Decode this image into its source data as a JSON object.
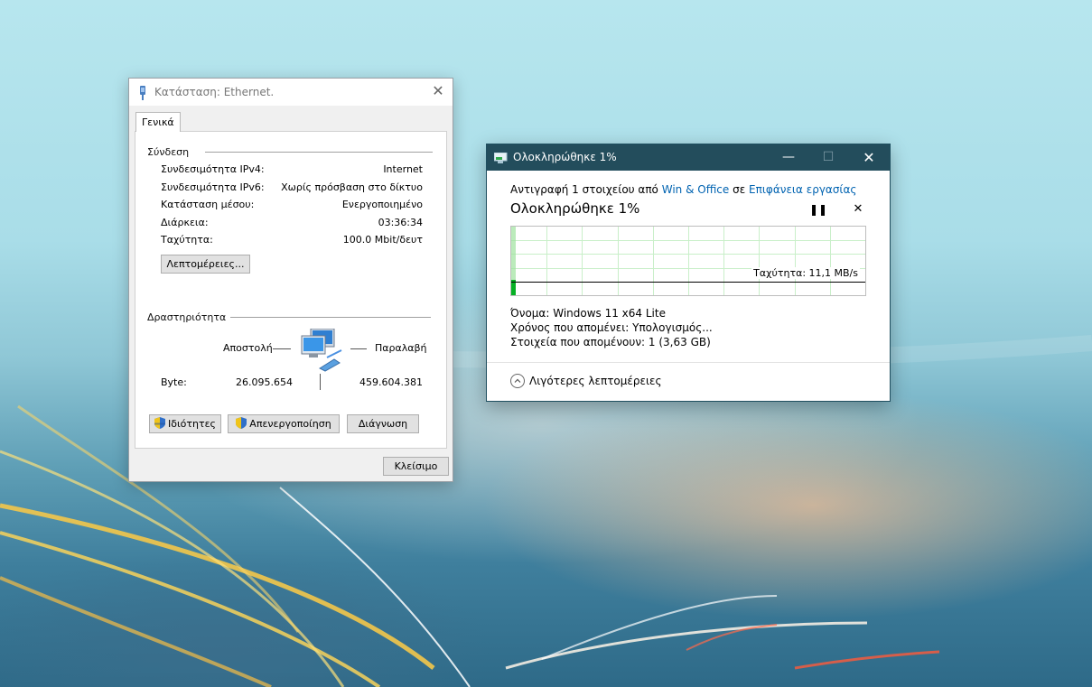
{
  "ethernet_dialog": {
    "title": "Κατάσταση: Ethernet.",
    "tab": "Γενικά",
    "connection": {
      "header": "Σύνδεση",
      "rows": [
        {
          "label": "Συνδεσιμότητα IPv4:",
          "value": "Internet"
        },
        {
          "label": "Συνδεσιμότητα IPv6:",
          "value": "Χωρίς πρόσβαση στο δίκτυο"
        },
        {
          "label": "Κατάσταση μέσου:",
          "value": "Ενεργοποιημένο"
        },
        {
          "label": "Διάρκεια:",
          "value": "03:36:34"
        },
        {
          "label": "Ταχύτητα:",
          "value": "100.0 Mbit/δευτ"
        }
      ],
      "details_button": "Λεπτομέρειες..."
    },
    "activity": {
      "header": "Δραστηριότητα",
      "sent_label": "Αποστολή",
      "received_label": "Παραλαβή",
      "bytes_label": "Byte:",
      "bytes_sent": "26.095.654",
      "bytes_received": "459.604.381"
    },
    "buttons": {
      "properties": "Ιδιότητες",
      "disable": "Απενεργοποίηση",
      "diagnose": "Διάγνωση",
      "close": "Κλείσιμο"
    }
  },
  "copy_dialog": {
    "title": "Ολοκληρώθηκε 1%",
    "copy_prefix": "Αντιγραφή 1 στοιχείου από",
    "source": "Win & Office",
    "to_word": "σε",
    "destination": "Επιφάνεια εργασίας",
    "heading": "Ολοκληρώθηκε 1%",
    "progress_percent": 1,
    "speed": "Ταχύτητα: 11,1 MB/s",
    "name_label": "Όνομα:",
    "name_value": "Windows 11 x64 Lite",
    "time_label": "Χρόνος που απομένει:",
    "time_value": "Υπολογισμός...",
    "items_label": "Στοιχεία που απομένουν:",
    "items_value": "1 (3,63 GB)",
    "less_details": "Λιγότερες λεπτομέρειες",
    "accent_color": "#06b025",
    "titlebar_color": "#234d5c"
  }
}
